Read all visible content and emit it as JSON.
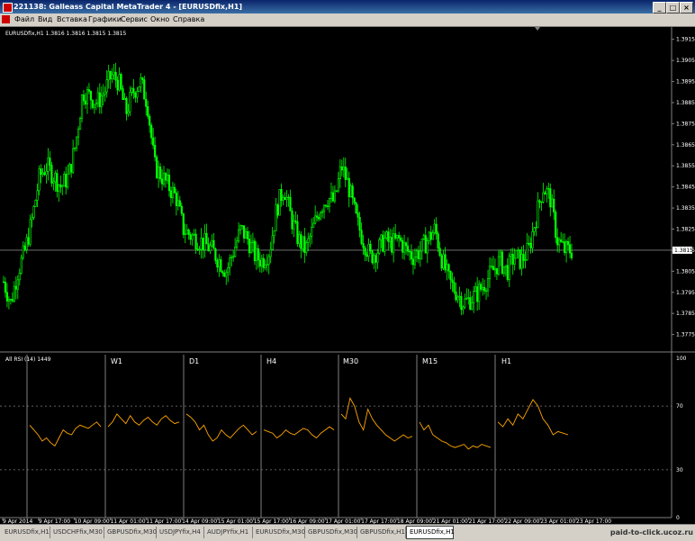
{
  "window": {
    "title": "221138: Galleass Capital MetaTrader 4 - [EURUSDfix,H1]"
  },
  "menu": [
    "Файл",
    "Вид",
    "Вставка",
    "Графики",
    "Сервис",
    "Окно",
    "Справка"
  ],
  "chart": {
    "header": "EURUSDfix,H1  1.3816 1.3816 1.3815 1.3815",
    "current_price": "1.3815",
    "sub_header": "All RSI (14) 1449",
    "timeframes": [
      "W1",
      "D1",
      "H4",
      "M30",
      "M15",
      "H1"
    ],
    "colors": {
      "background": "#000000",
      "bull": "#00ff00",
      "bear": "#00ff00",
      "rsi": "#ffa500",
      "grid": "#808080"
    }
  },
  "chart_data": [
    {
      "type": "candlestick",
      "title": "EURUSDfix,H1",
      "ylim": [
        1.3768,
        1.392
      ],
      "y_ticks": [
        "1.3915",
        "1.3905",
        "1.3895",
        "1.3885",
        "1.3875",
        "1.3865",
        "1.3855",
        "1.3845",
        "1.3835",
        "1.3825",
        "1.3815",
        "1.3805",
        "1.3795",
        "1.3785",
        "1.3775"
      ],
      "x_ticks": [
        "9 Apr 2014",
        "9 Apr 17:00",
        "10 Apr 09:00",
        "11 Apr 01:00",
        "11 Apr 17:00",
        "14 Apr 09:00",
        "15 Apr 01:00",
        "15 Apr 17:00",
        "16 Apr 09:00",
        "17 Apr 01:00",
        "17 Apr 17:00",
        "18 Apr 09:00",
        "21 Apr 01:00",
        "21 Apr 17:00",
        "22 Apr 09:00",
        "23 Apr 01:00",
        "23 Apr 17:00"
      ],
      "close_path": [
        1.38,
        1.379,
        1.3805,
        1.3815,
        1.383,
        1.385,
        1.3855,
        1.385,
        1.3845,
        1.385,
        1.3865,
        1.389,
        1.3888,
        1.3885,
        1.389,
        1.3898,
        1.3895,
        1.388,
        1.389,
        1.3895,
        1.3885,
        1.3855,
        1.385,
        1.3845,
        1.384,
        1.3825,
        1.3822,
        1.382,
        1.3818,
        1.3815,
        1.381,
        1.3805,
        1.3815,
        1.3825,
        1.382,
        1.3812,
        1.381,
        1.3815,
        1.3835,
        1.3845,
        1.383,
        1.382,
        1.3815,
        1.3825,
        1.3835,
        1.384,
        1.3838,
        1.3855,
        1.3845,
        1.383,
        1.382,
        1.3812,
        1.3815,
        1.382,
        1.3818,
        1.382,
        1.3815,
        1.3812,
        1.3815,
        1.382,
        1.3825,
        1.381,
        1.38,
        1.3795,
        1.379,
        1.3792,
        1.3795,
        1.38,
        1.3805,
        1.381,
        1.3805,
        1.3812,
        1.381,
        1.3815,
        1.383,
        1.3845,
        1.384,
        1.382,
        1.3815,
        1.3815
      ]
    },
    {
      "type": "line",
      "title": "All RSI (14) 1449",
      "ylim": [
        0,
        100
      ],
      "y_ticks": [
        "100",
        "70",
        "30",
        "0"
      ],
      "panels": [
        {
          "name": "",
          "values": [
            58,
            55,
            52,
            48,
            50,
            47,
            45,
            50,
            55,
            53,
            52,
            56,
            58,
            57,
            56,
            58,
            60,
            57
          ]
        },
        {
          "name": "W1",
          "values": [
            57,
            60,
            65,
            62,
            59,
            64,
            60,
            58,
            61,
            63,
            60,
            58,
            62,
            64,
            61,
            59,
            60
          ]
        },
        {
          "name": "D1",
          "values": [
            65,
            63,
            60,
            55,
            58,
            52,
            48,
            50,
            55,
            52,
            50,
            53,
            56,
            58,
            55,
            52,
            54
          ]
        },
        {
          "name": "H4",
          "values": [
            55,
            54,
            53,
            50,
            52,
            55,
            53,
            52,
            54,
            56,
            55,
            52,
            50,
            53,
            55,
            57,
            55
          ]
        },
        {
          "name": "M30",
          "values": [
            65,
            62,
            75,
            70,
            60,
            55,
            68,
            62,
            58,
            55,
            52,
            50,
            48,
            50,
            52,
            50,
            51
          ]
        },
        {
          "name": "M15",
          "values": [
            60,
            55,
            58,
            52,
            50,
            48,
            47,
            45,
            44,
            45,
            46,
            43,
            45,
            44,
            46,
            45,
            44
          ]
        },
        {
          "name": "H1",
          "values": [
            60,
            57,
            62,
            58,
            65,
            62,
            68,
            74,
            70,
            62,
            58,
            52,
            54,
            53,
            52
          ]
        }
      ]
    }
  ],
  "tabs": [
    "EURUSDfix,H1",
    "USDCHFfix,M30",
    "GBPUSDfix,M30",
    "USDJPYfix,H4",
    "AUDJPYfix,H1",
    "EURUSDfix,M30",
    "GBPUSDfix,M30",
    "GBPUSDfix,H1",
    "EURUSDfix,H1"
  ],
  "active_tab": 8,
  "watermark": "paid-to-click.ucoz.ru"
}
